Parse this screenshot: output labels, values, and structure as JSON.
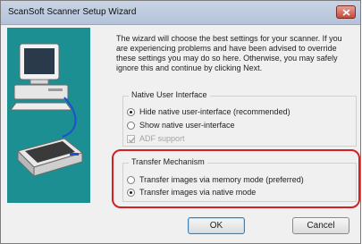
{
  "window": {
    "title": "ScanSoft Scanner Setup Wizard",
    "close_icon": "close-icon"
  },
  "description": "The wizard will choose the best settings for your scanner. If you are experiencing problems and have been advised to override these settings you may do so here. Otherwise, you may safely ignore this and continue by clicking Next.",
  "native_ui": {
    "title": "Native User Interface",
    "options": [
      {
        "label": "Hide native user-interface (recommended)",
        "selected": true
      },
      {
        "label": "Show native user-interface",
        "selected": false
      }
    ],
    "adf": {
      "label": "ADF support",
      "checked": true,
      "disabled": true
    }
  },
  "transfer": {
    "title": "Transfer Mechanism",
    "options": [
      {
        "label": "Transfer images via memory mode (preferred)",
        "selected": false
      },
      {
        "label": "Transfer images via native mode",
        "selected": true
      }
    ]
  },
  "buttons": {
    "ok": "OK",
    "cancel": "Cancel"
  },
  "colors": {
    "illustration_bg": "#1c8f92",
    "highlight": "#d42020"
  }
}
